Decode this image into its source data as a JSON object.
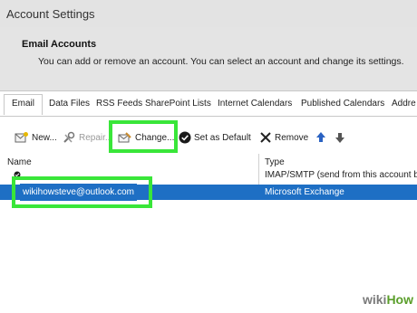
{
  "window": {
    "title": "Account Settings"
  },
  "header": {
    "title": "Email Accounts",
    "description": "You can add or remove an account. You can select an account and change its settings."
  },
  "tabs": [
    {
      "label": "Email",
      "active": true
    },
    {
      "label": "Data Files"
    },
    {
      "label": "RSS Feeds"
    },
    {
      "label": "SharePoint Lists"
    },
    {
      "label": "Internet Calendars"
    },
    {
      "label": "Published Calendars"
    },
    {
      "label": "Addre"
    }
  ],
  "toolbar": {
    "new_label": "New...",
    "repair_label": "Repair...",
    "change_label": "Change...",
    "set_default_label": "Set as Default",
    "remove_label": "Remove"
  },
  "list": {
    "columns": [
      "Name",
      "Type"
    ],
    "rows": [
      {
        "name": "",
        "type": "IMAP/SMTP (send from this account b"
      },
      {
        "name": "wikihowsteve@outlook.com",
        "type": "Microsoft Exchange",
        "selected": true
      }
    ]
  },
  "colors": {
    "highlight": "#39e639",
    "selection": "#1e6fc4"
  },
  "watermark": {
    "part1": "wiki",
    "part2": "How"
  }
}
